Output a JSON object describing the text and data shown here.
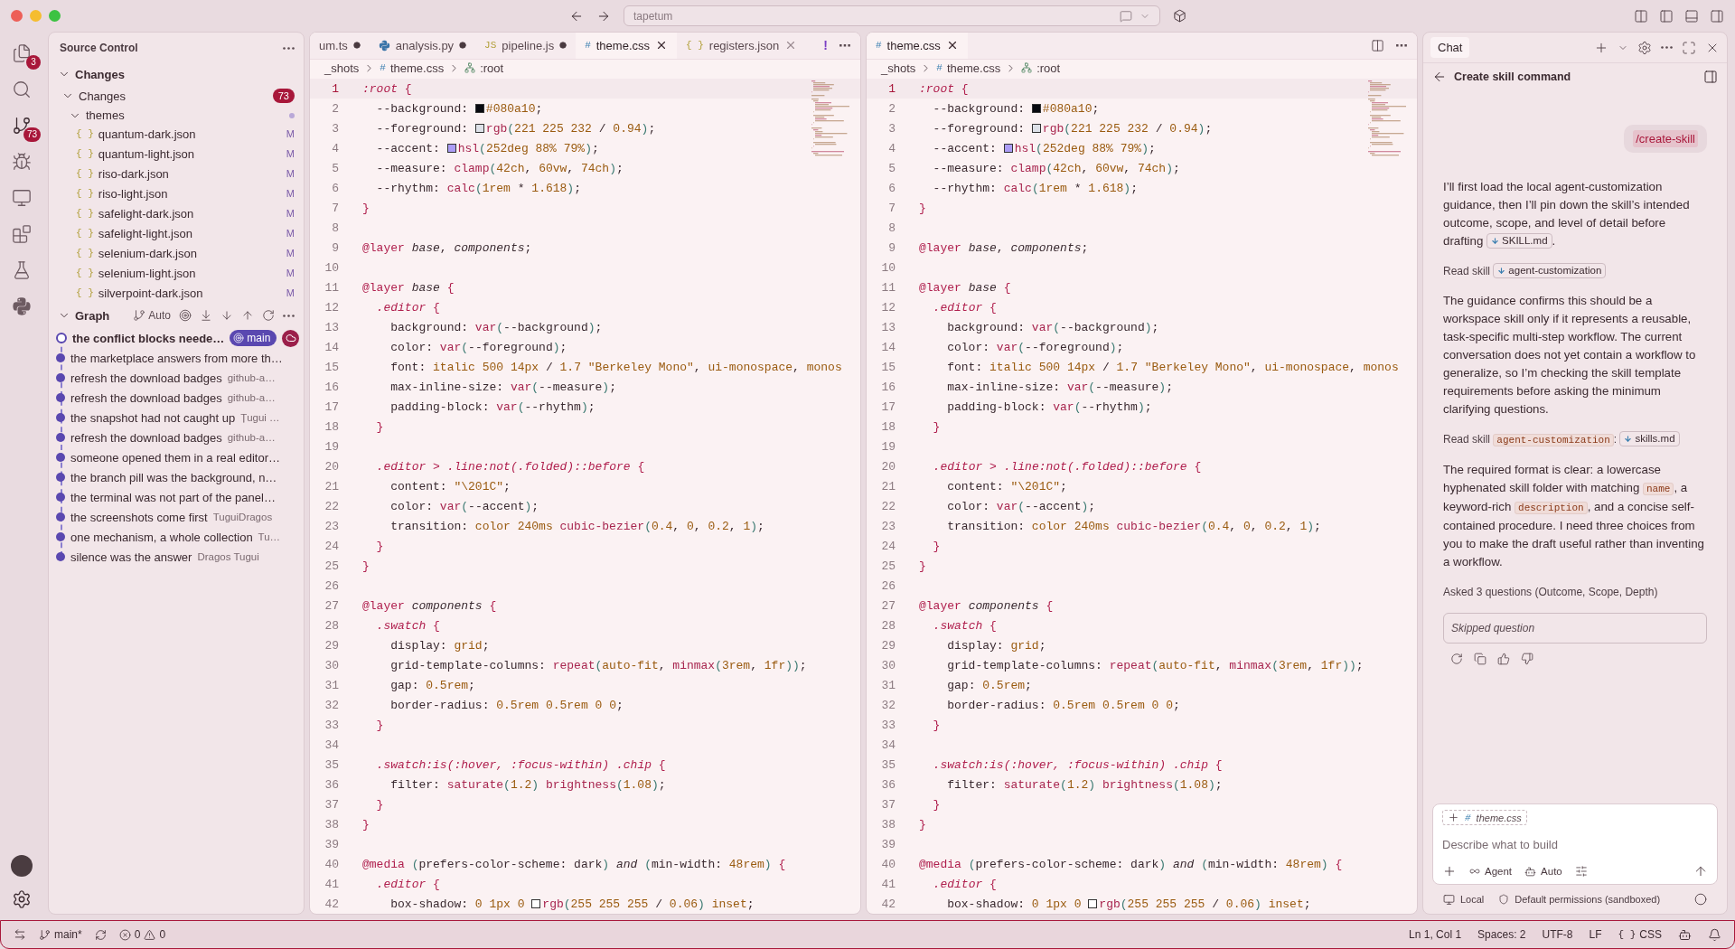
{
  "titlebar": {
    "title": "tapetum"
  },
  "activity_bar": {
    "items": [
      {
        "kind": "files",
        "badge": "3",
        "selected": false
      },
      {
        "kind": "search",
        "selected": false
      },
      {
        "kind": "source-control",
        "badge": "73",
        "selected": true
      },
      {
        "kind": "run",
        "selected": false
      },
      {
        "kind": "remote",
        "selected": false
      },
      {
        "kind": "extensions",
        "selected": false
      },
      {
        "kind": "testing",
        "selected": false
      },
      {
        "kind": "python",
        "selected": false
      }
    ]
  },
  "sidebar": {
    "title": "Source Control",
    "section": {
      "title": "Changes",
      "expanded": true,
      "groups": [
        {
          "label": "Changes",
          "count": "73",
          "expanded": true,
          "children": [
            {
              "label": "themes",
              "expanded": true,
              "modified": true,
              "children": [
                {
                  "glyph": "{ }",
                  "label": "quantum-dark.json",
                  "status": "M"
                },
                {
                  "glyph": "{ }",
                  "label": "quantum-light.json",
                  "status": "M"
                },
                {
                  "glyph": "{ }",
                  "label": "riso-dark.json",
                  "status": "M"
                },
                {
                  "glyph": "{ }",
                  "label": "riso-light.json",
                  "status": "M"
                },
                {
                  "glyph": "{ }",
                  "label": "safelight-dark.json",
                  "status": "M"
                },
                {
                  "glyph": "{ }",
                  "label": "safelight-light.json",
                  "status": "M"
                },
                {
                  "glyph": "{ }",
                  "label": "selenium-dark.json",
                  "status": "M"
                },
                {
                  "glyph": "{ }",
                  "label": "selenium-light.json",
                  "status": "M"
                },
                {
                  "glyph": "{ }",
                  "label": "silverpoint-dark.json",
                  "status": "M"
                }
              ]
            }
          ]
        }
      ]
    },
    "graph": {
      "title": "Graph",
      "expanded": true,
      "mode": "Auto",
      "commits": [
        {
          "message": "the conflict blocks neede…",
          "head": true,
          "ref": "main"
        },
        {
          "message": "the marketplace answers from more th…",
          "head": false
        },
        {
          "message": "refresh the download badges",
          "author": "github-a…",
          "head": false
        },
        {
          "message": "refresh the download badges",
          "author": "github-a…",
          "head": false
        },
        {
          "message": "the snapshot had not caught up",
          "author": "Țugui …",
          "head": false
        },
        {
          "message": "refresh the download badges",
          "author": "github-a…",
          "head": false
        },
        {
          "message": "someone opened them in a real editor…",
          "head": false
        },
        {
          "message": "the branch pill was the background, n…",
          "head": false
        },
        {
          "message": "the terminal was not part of the panel…",
          "head": false
        },
        {
          "message": "the screenshots come first",
          "author": "TuguiDragos",
          "head": false
        },
        {
          "message": "one mechanism, a whole collection",
          "author": "Tu…",
          "head": false
        },
        {
          "message": "silence was the answer",
          "author": "Dragos Tugui",
          "head": false
        }
      ]
    }
  },
  "editors": [
    {
      "tabs": [
        {
          "kind": "plain",
          "label": "um.ts",
          "dirty": true,
          "selected": false
        },
        {
          "kind": "python",
          "label": "analysis.py",
          "dirty": true,
          "selected": false
        },
        {
          "kind": "glyph",
          "glyph": "JS",
          "label": "pipeline.js",
          "dirty": true,
          "selected": false
        },
        {
          "kind": "glyph",
          "glyph": "#",
          "label": "theme.css",
          "dirty": false,
          "selected": true
        },
        {
          "kind": "glyph",
          "glyph": "{ }",
          "label": "registers.json",
          "dirty": false,
          "selected": false
        }
      ],
      "actions": [
        {
          "kind": "text",
          "text": "!"
        },
        {
          "kind": "text",
          "text": "⋯"
        }
      ],
      "breadcrumbs": [
        {
          "kind": "folder",
          "label": "_shots"
        },
        {
          "kind": "file",
          "glyph": "#",
          "label": "theme.css"
        },
        {
          "kind": "symbol",
          "label": ":root"
        }
      ],
      "lines": [
        {
          "n": "1",
          "text": ":root {",
          "selected": true
        },
        {
          "n": "2",
          "text": "  --background: #080a10;",
          "color": "#080a10",
          "selected": false
        },
        {
          "n": "3",
          "text": "  --foreground: rgb(221 225 232 / 0.94);",
          "color": "#dde1e8",
          "selected": false
        },
        {
          "n": "4",
          "text": "  --accent: hsl(252deg 88% 79%);",
          "color": "#ab9cf6",
          "selected": false
        },
        {
          "n": "5",
          "text": "  --measure: clamp(42ch, 60vw, 74ch);",
          "selected": false
        },
        {
          "n": "6",
          "text": "  --rhythm: calc(1rem * 1.618);",
          "selected": false
        },
        {
          "n": "7",
          "text": "}",
          "selected": false
        },
        {
          "n": "8",
          "selected": false
        },
        {
          "n": "9",
          "text": "@layer base, components;",
          "selected": false
        },
        {
          "n": "10",
          "selected": false
        },
        {
          "n": "11",
          "text": "@layer base {",
          "selected": false
        },
        {
          "n": "12",
          "text": "  .editor {",
          "selected": false
        },
        {
          "n": "13",
          "text": "    background: var(--background);",
          "selected": false
        },
        {
          "n": "14",
          "text": "    color: var(--foreground);",
          "selected": false
        },
        {
          "n": "15",
          "text": "    font: italic 500 14px / 1.7 \"Berkeley Mono\", ui-monospace, monos",
          "selected": false
        },
        {
          "n": "16",
          "text": "    max-inline-size: var(--measure);",
          "selected": false
        },
        {
          "n": "17",
          "text": "    padding-block: var(--rhythm);",
          "selected": false
        },
        {
          "n": "18",
          "text": "  }",
          "selected": false
        },
        {
          "n": "19",
          "selected": false
        },
        {
          "n": "20",
          "text": "  .editor > .line:not(.folded)::before {",
          "selected": false
        },
        {
          "n": "21",
          "text": "    content: \"\\201C\";",
          "selected": false
        },
        {
          "n": "22",
          "text": "    color: var(--accent);",
          "selected": false
        },
        {
          "n": "23",
          "text": "    transition: color 240ms cubic-bezier(0.4, 0, 0.2, 1);",
          "selected": false
        },
        {
          "n": "24",
          "text": "  }",
          "selected": false
        },
        {
          "n": "25",
          "text": "}",
          "selected": false
        },
        {
          "n": "26",
          "selected": false
        },
        {
          "n": "27",
          "text": "@layer components {",
          "selected": false
        },
        {
          "n": "28",
          "text": "  .swatch {",
          "selected": false
        },
        {
          "n": "29",
          "text": "    display: grid;",
          "selected": false
        },
        {
          "n": "30",
          "text": "    grid-template-columns: repeat(auto-fit, minmax(3rem, 1fr));",
          "selected": false
        },
        {
          "n": "31",
          "text": "    gap: 0.5rem;",
          "selected": false
        },
        {
          "n": "32",
          "text": "    border-radius: 0.5rem 0.5rem 0 0;",
          "selected": false
        },
        {
          "n": "33",
          "text": "  }",
          "selected": false
        },
        {
          "n": "34",
          "selected": false
        },
        {
          "n": "35",
          "text": "  .swatch:is(:hover, :focus-within) .chip {",
          "selected": false
        },
        {
          "n": "36",
          "text": "    filter: saturate(1.2) brightness(1.08);",
          "selected": false
        },
        {
          "n": "37",
          "text": "  }",
          "selected": false
        },
        {
          "n": "38",
          "text": "}",
          "selected": false
        },
        {
          "n": "39",
          "selected": false
        },
        {
          "n": "40",
          "text": "@media (prefers-color-scheme: dark) and (min-width: 48rem) {",
          "selected": false
        },
        {
          "n": "41",
          "text": "  .editor {",
          "selected": false
        },
        {
          "n": "42",
          "text": "    box-shadow: 0 1px 0 rgb(255 255 255 / 0.06) inset;",
          "color": "#ffffff",
          "selected": false
        }
      ]
    },
    {
      "tabs": [
        {
          "kind": "glyph",
          "glyph": "#",
          "label": "theme.css",
          "dirty": false,
          "selected": true
        }
      ],
      "actions": [
        {
          "kind": "split"
        },
        {
          "kind": "text",
          "text": "⋯"
        }
      ],
      "breadcrumbs": [
        {
          "kind": "folder",
          "label": "_shots"
        },
        {
          "kind": "file",
          "glyph": "#",
          "label": "theme.css"
        },
        {
          "kind": "symbol",
          "label": ":root"
        }
      ],
      "lines": [
        {
          "n": "1",
          "text": ":root {",
          "selected": true
        },
        {
          "n": "2",
          "text": "  --background: #080a10;",
          "color": "#080a10",
          "selected": false
        },
        {
          "n": "3",
          "text": "  --foreground: rgb(221 225 232 / 0.94);",
          "color": "#dde1e8",
          "selected": false
        },
        {
          "n": "4",
          "text": "  --accent: hsl(252deg 88% 79%);",
          "color": "#ab9cf6",
          "selected": false
        },
        {
          "n": "5",
          "text": "  --measure: clamp(42ch, 60vw, 74ch);",
          "selected": false
        },
        {
          "n": "6",
          "text": "  --rhythm: calc(1rem * 1.618);",
          "selected": false
        },
        {
          "n": "7",
          "text": "}",
          "selected": false
        },
        {
          "n": "8",
          "selected": false
        },
        {
          "n": "9",
          "text": "@layer base, components;",
          "selected": false
        },
        {
          "n": "10",
          "selected": false
        },
        {
          "n": "11",
          "text": "@layer base {",
          "selected": false
        },
        {
          "n": "12",
          "text": "  .editor {",
          "selected": false
        },
        {
          "n": "13",
          "text": "    background: var(--background);",
          "selected": false
        },
        {
          "n": "14",
          "text": "    color: var(--foreground);",
          "selected": false
        },
        {
          "n": "15",
          "text": "    font: italic 500 14px / 1.7 \"Berkeley Mono\", ui-monospace, monos",
          "selected": false
        },
        {
          "n": "16",
          "text": "    max-inline-size: var(--measure);",
          "selected": false
        },
        {
          "n": "17",
          "text": "    padding-block: var(--rhythm);",
          "selected": false
        },
        {
          "n": "18",
          "text": "  }",
          "selected": false
        },
        {
          "n": "19",
          "selected": false
        },
        {
          "n": "20",
          "text": "  .editor > .line:not(.folded)::before {",
          "selected": false
        },
        {
          "n": "21",
          "text": "    content: \"\\201C\";",
          "selected": false
        },
        {
          "n": "22",
          "text": "    color: var(--accent);",
          "selected": false
        },
        {
          "n": "23",
          "text": "    transition: color 240ms cubic-bezier(0.4, 0, 0.2, 1);",
          "selected": false
        },
        {
          "n": "24",
          "text": "  }",
          "selected": false
        },
        {
          "n": "25",
          "text": "}",
          "selected": false
        },
        {
          "n": "26",
          "selected": false
        },
        {
          "n": "27",
          "text": "@layer components {",
          "selected": false
        },
        {
          "n": "28",
          "text": "  .swatch {",
          "selected": false
        },
        {
          "n": "29",
          "text": "    display: grid;",
          "selected": false
        },
        {
          "n": "30",
          "text": "    grid-template-columns: repeat(auto-fit, minmax(3rem, 1fr));",
          "selected": false
        },
        {
          "n": "31",
          "text": "    gap: 0.5rem;",
          "selected": false
        },
        {
          "n": "32",
          "text": "    border-radius: 0.5rem 0.5rem 0 0;",
          "selected": false
        },
        {
          "n": "33",
          "text": "  }",
          "selected": false
        },
        {
          "n": "34",
          "selected": false
        },
        {
          "n": "35",
          "text": "  .swatch:is(:hover, :focus-within) .chip {",
          "selected": false
        },
        {
          "n": "36",
          "text": "    filter: saturate(1.2) brightness(1.08);",
          "selected": false
        },
        {
          "n": "37",
          "text": "  }",
          "selected": false
        },
        {
          "n": "38",
          "text": "}",
          "selected": false
        },
        {
          "n": "39",
          "selected": false
        },
        {
          "n": "40",
          "text": "@media (prefers-color-scheme: dark) and (min-width: 48rem) {",
          "selected": false
        },
        {
          "n": "41",
          "text": "  .editor {",
          "selected": false
        },
        {
          "n": "42",
          "text": "    box-shadow: 0 1px 0 rgb(255 255 255 / 0.06) inset;",
          "color": "#ffffff",
          "selected": false
        }
      ]
    }
  ],
  "chat": {
    "tab": "Chat",
    "title": "Create skill command",
    "user_message": "/create-skill",
    "messages": [
      {
        "kind": "paragraph",
        "segments": [
          {
            "kind": "text",
            "text": "I’ll first load the local agent-customization guidance, then I’ll pin down the skill’s intended outcome, scope, and level of detail before drafting "
          },
          {
            "kind": "file",
            "text": "SKILL.md"
          },
          {
            "kind": "text",
            "text": "."
          }
        ]
      },
      {
        "kind": "tool",
        "segments": [
          {
            "kind": "text",
            "text": "Read skill "
          },
          {
            "kind": "file",
            "text": "agent-customization"
          }
        ]
      },
      {
        "kind": "paragraph",
        "segments": [
          {
            "kind": "text",
            "text": "The guidance confirms this should be a workspace skill only if it represents a reusable, task-specific multi-step workflow. The current conversation does not yet contain a workflow to generalize, so I’m checking the skill template requirements before asking the minimum clarifying questions."
          }
        ]
      },
      {
        "kind": "tool",
        "segments": [
          {
            "kind": "text",
            "text": "Read skill "
          },
          {
            "kind": "code",
            "text": "agent-customization"
          },
          {
            "kind": "text",
            "text": ": "
          },
          {
            "kind": "file",
            "text": "skills.md"
          }
        ]
      },
      {
        "kind": "paragraph",
        "segments": [
          {
            "kind": "text",
            "text": "The required format is clear: a lowercase hyphenated skill folder with matching "
          },
          {
            "kind": "code",
            "text": "name"
          },
          {
            "kind": "text",
            "text": ", a keyword-rich "
          },
          {
            "kind": "code",
            "text": "description"
          },
          {
            "kind": "text",
            "text": ", and a concise self-contained procedure. I need three choices from you to make the draft useful rather than inventing a workflow."
          }
        ]
      },
      {
        "kind": "tool",
        "segments": [
          {
            "kind": "text",
            "text": "Asked 3 questions (Outcome, Scope, Depth)"
          }
        ]
      }
    ],
    "skipped": "Skipped question",
    "input": {
      "context_glyph": "#",
      "context": "theme.css",
      "placeholder": "Describe what to build",
      "mode": "Agent",
      "model": "Auto"
    },
    "footer": {
      "location": "Local",
      "permissions": "Default permissions (sandboxed)"
    }
  },
  "status_bar": {
    "branch": "main*",
    "errors": "0",
    "warnings": "0",
    "items": [
      "Ln 1, Col 1",
      "Spaces: 2",
      "UTF-8",
      "LF"
    ],
    "language_glyph": "{ }",
    "language": "CSS"
  }
}
